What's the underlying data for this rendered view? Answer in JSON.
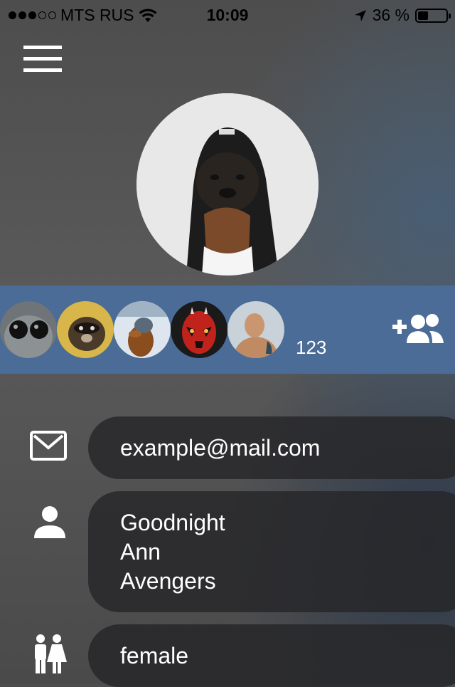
{
  "status_bar": {
    "carrier": "MTS RUS",
    "time": "10:09",
    "battery": "36 %",
    "signal_bars_filled": 3,
    "signal_bars_total": 5,
    "battery_level": 0.36
  },
  "profile": {
    "email": "example@mail.com",
    "name_lines": [
      "Goodnight",
      "Ann",
      "Avengers"
    ],
    "gender": "female"
  },
  "friends": {
    "count": "123",
    "avatars": [
      "cat-avatar",
      "raccoon-avatar",
      "dog-avatar",
      "darth-maul-avatar",
      "wrestler-avatar"
    ]
  },
  "icons": {
    "menu": "menu-icon",
    "add_friend": "add-friend-icon",
    "email": "envelope-icon",
    "name": "person-icon",
    "gender": "gender-icon"
  },
  "colors": {
    "friends_bar": "#4a6c96",
    "field_bg": "#262628"
  }
}
